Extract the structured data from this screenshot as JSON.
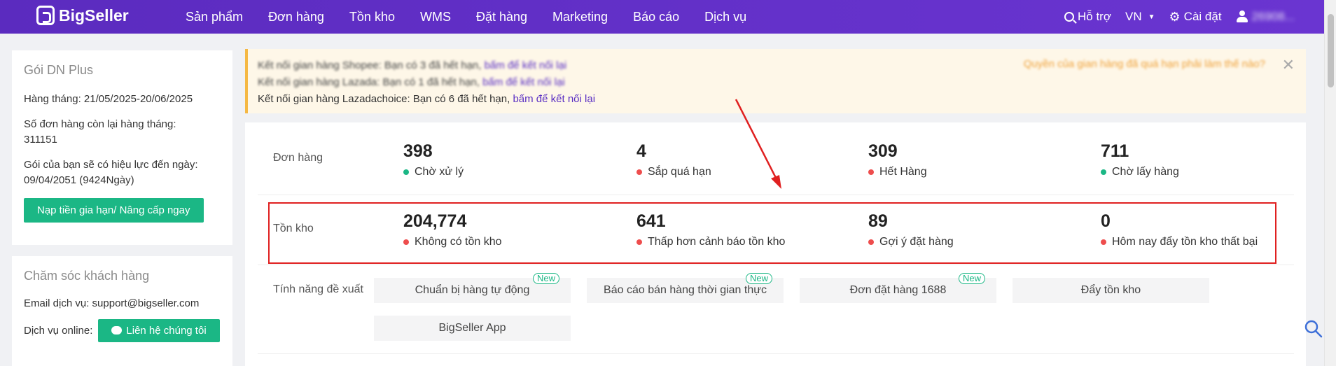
{
  "brand": {
    "name": "BigSeller"
  },
  "nav": [
    "Sản phẩm",
    "Đơn hàng",
    "Tồn kho",
    "WMS",
    "Đặt hàng",
    "Marketing",
    "Báo cáo",
    "Dịch vụ"
  ],
  "right_nav": {
    "help": "Hỗ trợ",
    "lang": "VN",
    "settings": "Cài đặt",
    "user": "26908..."
  },
  "plan": {
    "title": "Gói DN Plus",
    "monthly": "Hàng tháng: 21/05/2025-20/06/2025",
    "orders_left_label": "Số đơn hàng còn lại hàng tháng:",
    "orders_left_value": "311151",
    "valid_label": "Gói của bạn sẽ có hiệu lực đến ngày:",
    "valid_value": "09/04/2051 (9424Ngày)",
    "upgrade_button": "Nạp tiền gia hạn/ Nâng cấp ngay"
  },
  "care": {
    "title": "Chăm sóc khách hàng",
    "email": "Email dịch vụ: support@bigseller.com",
    "online_label": "Dịch vụ online:",
    "contact_button": "Liên hệ chúng tôi"
  },
  "alert": {
    "line1_text": "Kết nối gian hàng Shopee: Bạn có 3 đã hết hạn, ",
    "line1_link": "bấm để kết nối lại",
    "line2_text": "Kết nối gian hàng Lazada: Bạn có 1 đã hết hạn, ",
    "line2_link": "bấm để kết nối lại",
    "line3_text": "Kết nối gian hàng Lazadachoice: Bạn có 6 đã hết hạn, ",
    "line3_link": "bấm để kết nối lại",
    "right_link": "Quyền của gian hàng đã quá hạn phải làm thế nào?",
    "close": "✕"
  },
  "orders": {
    "label": "Đơn hàng",
    "stats": [
      {
        "value": "398",
        "label": "Chờ xử lý",
        "dot": "green"
      },
      {
        "value": "4",
        "label": "Sắp quá hạn",
        "dot": "red"
      },
      {
        "value": "309",
        "label": "Hết Hàng",
        "dot": "red"
      },
      {
        "value": "711",
        "label": "Chờ lấy hàng",
        "dot": "green"
      }
    ]
  },
  "inventory": {
    "label": "Tồn kho",
    "stats": [
      {
        "value": "204,774",
        "label": "Không có tồn kho",
        "dot": "red"
      },
      {
        "value": "641",
        "label": "Thấp hơn cảnh báo tồn kho",
        "dot": "red"
      },
      {
        "value": "89",
        "label": "Gợi ý đặt hàng",
        "dot": "red"
      },
      {
        "value": "0",
        "label": "Hôm nay đẩy tồn kho thất bại",
        "dot": "red"
      }
    ]
  },
  "features": {
    "label": "Tính năng đề xuất",
    "items": [
      {
        "label": "Chuẩn bị hàng tự động",
        "badge": "New"
      },
      {
        "label": "Báo cáo bán hàng thời gian thực",
        "badge": "New"
      },
      {
        "label": "Đơn đặt hàng 1688",
        "badge": "New"
      },
      {
        "label": "Đẩy tồn kho",
        "badge": ""
      },
      {
        "label": "BigSeller App",
        "badge": ""
      }
    ]
  },
  "colors": {
    "brand": "#5b2bbf",
    "accent_green": "#1bb785",
    "highlight_red": "#e02020",
    "alert_bg": "#fef7e8"
  }
}
